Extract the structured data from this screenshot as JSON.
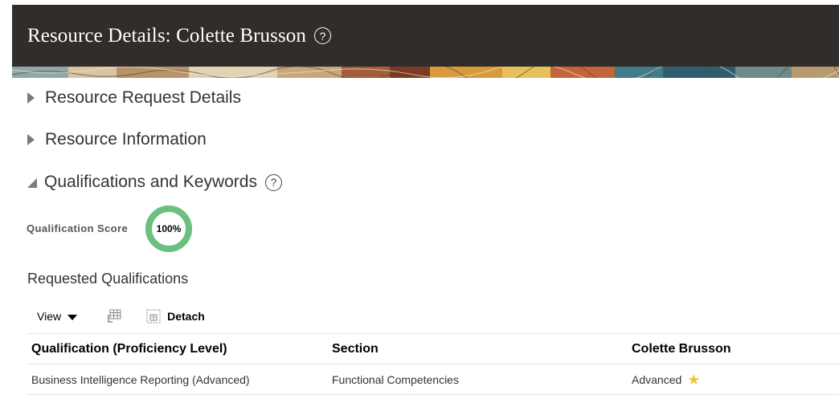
{
  "header": {
    "title": "Resource Details: Colette Brusson",
    "help_glyph": "?"
  },
  "sections": [
    {
      "label": "Resource Request Details",
      "expanded": false
    },
    {
      "label": "Resource Information",
      "expanded": false
    },
    {
      "label": "Qualifications and Keywords",
      "expanded": true,
      "help_glyph": "?"
    }
  ],
  "qualification_score": {
    "label": "Qualification Score",
    "value_text": "100%",
    "value_fraction": 1.0,
    "ring_color": "#6bbf7f"
  },
  "requested_qualifications": {
    "heading": "Requested Qualifications",
    "toolbar": {
      "view_label": "View",
      "freeze_icon": "table-freeze-icon",
      "detach_icon": "detach-icon",
      "detach_label": "Detach"
    },
    "columns": [
      "Qualification (Proficiency Level)",
      "Section",
      "Colette Brusson"
    ],
    "rows": [
      {
        "qualification": "Business Intelligence Reporting (Advanced)",
        "section": "Functional Competencies",
        "level": "Advanced",
        "match_icon": "star-icon"
      }
    ]
  },
  "colors": {
    "header_bg": "#312d2a",
    "star": "#f0c23b"
  }
}
